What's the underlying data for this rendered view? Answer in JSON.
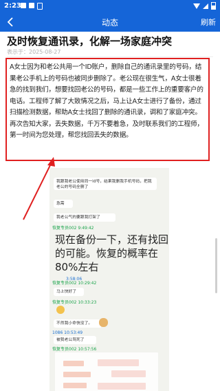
{
  "status_bar": {
    "time": "2:23"
  },
  "app_bar": {
    "title": "动态",
    "refresh_label": "刷新"
  },
  "article": {
    "title": "及时恢复通讯录，化解一场家庭冲突",
    "meta": "表示于：2025-08-27",
    "body": "A女士因为和老公共用一个ID账户，删除自己的通讯录里的号码，结果老公手机上的号码也被同步删除了。老公现在很生气，A女士很着急的找到我们，想要找回老公的号码，都是一些工作上的重要客户的电话。工程师了解了大致情况之后，马上让A女士进行了备份，通过扫描检测数据，帮助A女士找回了删除的通讯录，调和了家庭冲突。再次告知大家，丢失数据，千万不要着急，及时联系我们的工程师，第一时间为您处理，帮您找回丢失的数据。"
  },
  "chat": {
    "msg1": "我跟我老公使用同一id号，结果我删我手机号码，把我老公的号码全删了",
    "msg2": "急需",
    "msg3": "我老公气的要跟我打架了",
    "time1": "恢复专员002 9:49:42",
    "big_msg": "现在备份一下，还有找回的可能。恢复的概率在 80%左右",
    "time2": "恢复专员002 10:29:42",
    "msg4": "马上快好了",
    "time3": "恢复专员002 10:33:23",
    "msg5": "不然我小命快没了。",
    "time4": "1086 10:53:49",
    "msg6": "被我老公骂死了",
    "time5": "恢复专员002 10:57:56",
    "time6": "3:58:06"
  }
}
